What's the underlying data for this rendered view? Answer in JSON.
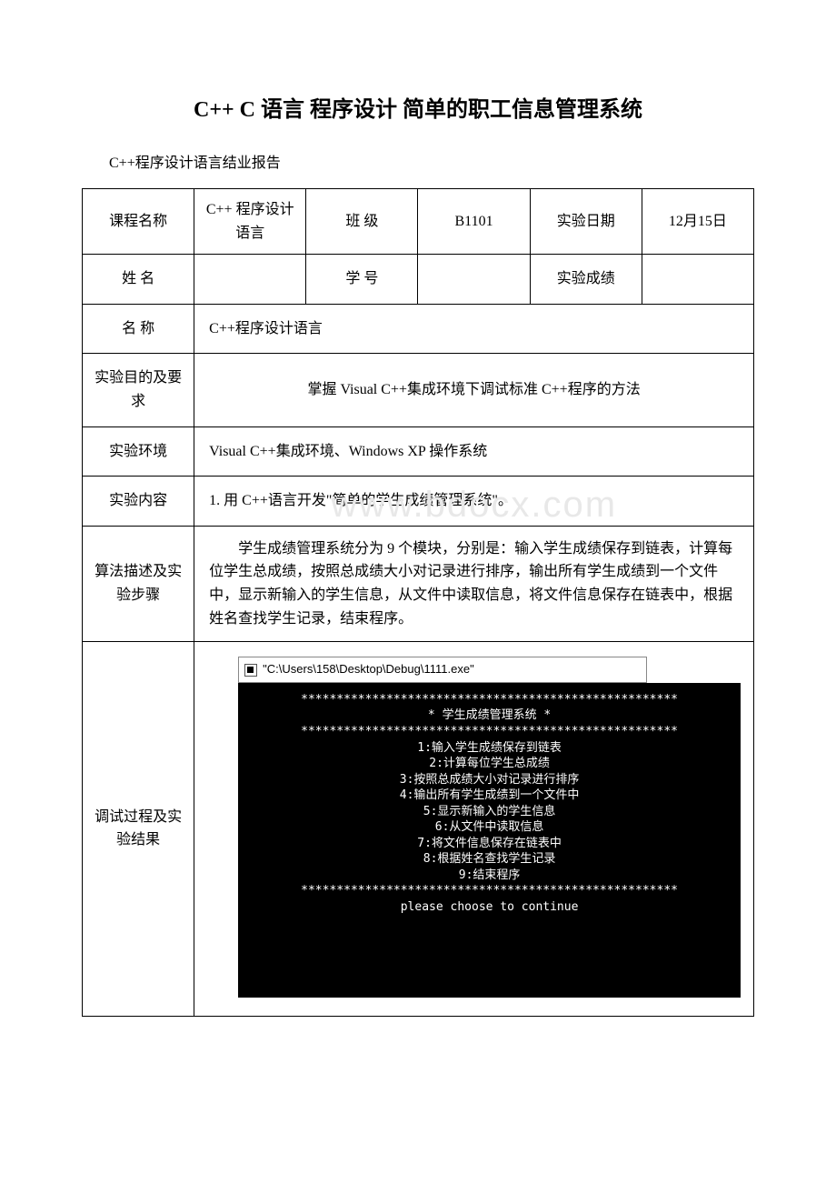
{
  "title": "C++ C 语言 程序设计 简单的职工信息管理系统",
  "subtitle": "C++程序设计语言结业报告",
  "table": {
    "r1": {
      "course_label": "课程名称",
      "course_value": "C++ 程序设计语言",
      "class_label": "班 级",
      "class_value": "B1101",
      "date_label": "实验日期",
      "date_value": "12月15日"
    },
    "r2": {
      "name_label": "姓 名",
      "name_value": "",
      "id_label": "学 号",
      "id_value": "",
      "score_label": "实验成绩",
      "score_value": ""
    },
    "r3": {
      "label": "名 称",
      "value": "C++程序设计语言"
    },
    "r4": {
      "label": "实验目的及要求",
      "value": "掌握 Visual C++集成环境下调试标准 C++程序的方法"
    },
    "r5": {
      "label": "实验环境",
      "value": "Visual C++集成环境、Windows XP 操作系统"
    },
    "r6": {
      "label": "实验内容",
      "value": "1. 用 C++语言开发\"简单的学生成绩管理系统\"。"
    },
    "r7": {
      "label": "算法描述及实验步骤",
      "value": "学生成绩管理系统分为 9 个模块，分别是：输入学生成绩保存到链表，计算每位学生总成绩，按照总成绩大小对记录进行排序，输出所有学生成绩到一个文件中，显示新输入的学生信息，从文件中读取信息，将文件信息保存在链表中，根据姓名查找学生记录，结束程序。"
    },
    "r8": {
      "label": "调试过程及实验结果"
    }
  },
  "console": {
    "path": "\"C:\\Users\\158\\Desktop\\Debug\\1111.exe\"",
    "stars1": "*****************************************************",
    "header": "* 学生成绩管理系统 *",
    "stars2": "*****************************************************",
    "m1": "1:输入学生成绩保存到链表",
    "m2": "2:计算每位学生总成绩",
    "m3": "3:按照总成绩大小对记录进行排序",
    "m4": "4:输出所有学生成绩到一个文件中",
    "m5": "5:显示新输入的学生信息",
    "m6": "6:从文件中读取信息",
    "m7": "7:将文件信息保存在链表中",
    "m8": "8:根据姓名查找学生记录",
    "m9": "9:结束程序",
    "stars3": "*****************************************************",
    "prompt": "please choose to continue"
  },
  "watermark": "www.bdocx.com"
}
